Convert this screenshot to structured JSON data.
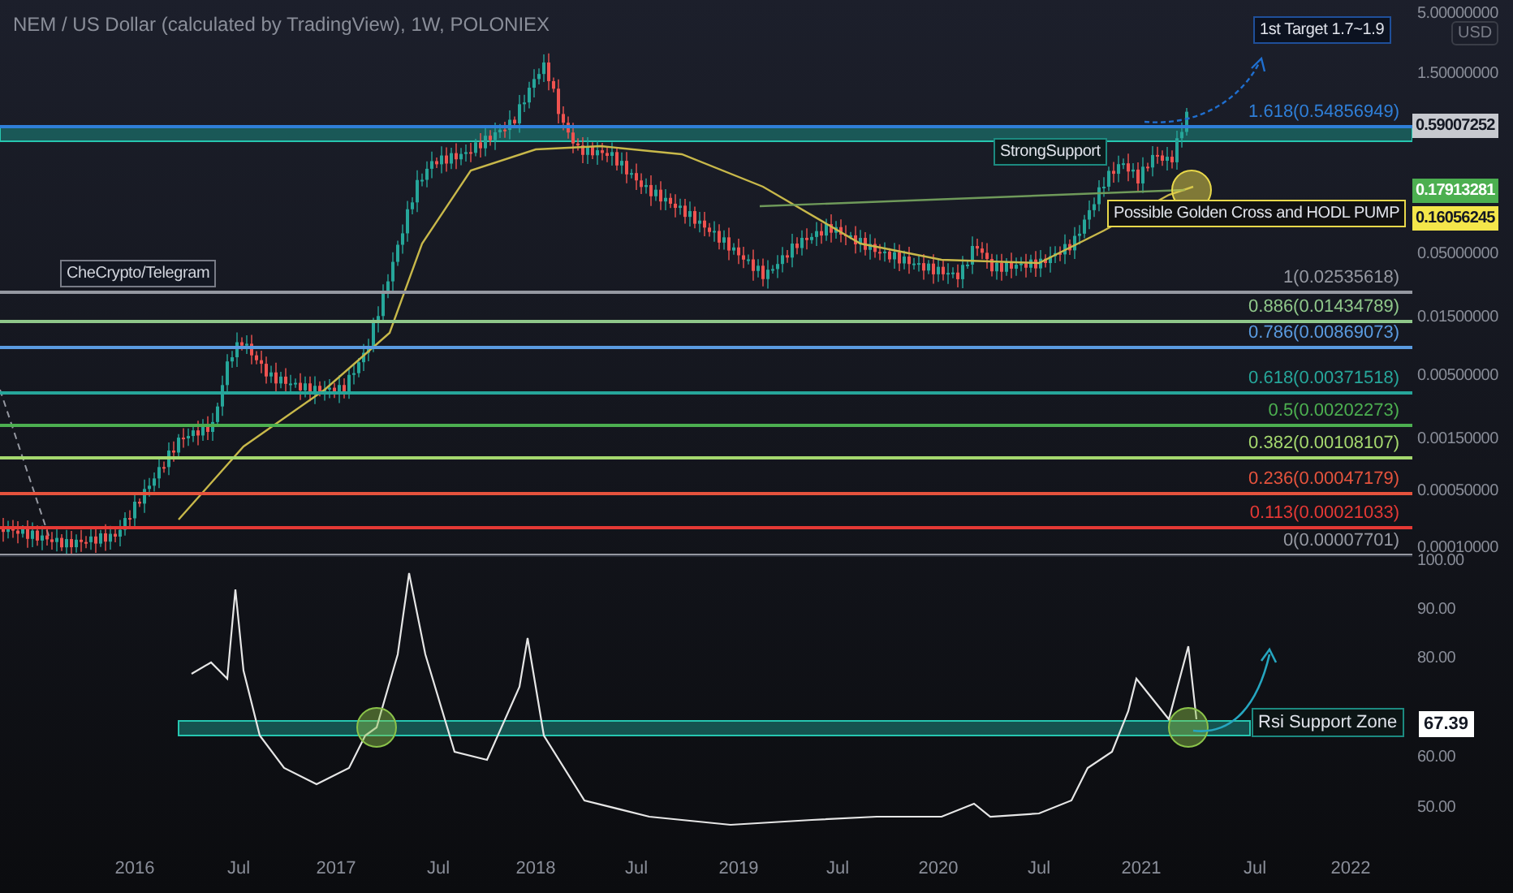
{
  "chart": {
    "title": "NEM / US Dollar (calculated by TradingView), 1W, POLONIEX"
  },
  "annotations": [
    {
      "kind": "target",
      "text": "1st Target 1.7~1.9"
    },
    {
      "kind": "support",
      "text": "StrongSupport"
    },
    {
      "kind": "note",
      "text": "Possible Golden Cross and HODL PUMP"
    },
    {
      "kind": "label",
      "text": "CheCrypto/Telegram"
    }
  ],
  "fib_levels": [
    {
      "label": "1.618(0.54856949)",
      "color": "#2f7fd8"
    },
    {
      "label": "1(0.02535618)",
      "color": "#9598a1"
    },
    {
      "label": "0.886(0.01434789)",
      "color": "#8fc78a"
    },
    {
      "label": "0.786(0.00869073)",
      "color": "#5a9be0"
    },
    {
      "label": "0.618(0.00371518)",
      "color": "#26a69a"
    },
    {
      "label": "0.5(0.00202273)",
      "color": "#4caf50"
    },
    {
      "label": "0.382(0.00108107)",
      "color": "#a5d86e"
    },
    {
      "label": "0.236(0.00047179)",
      "color": "#e5533d"
    },
    {
      "label": "0.113(0.00021033)",
      "color": "#e53935"
    },
    {
      "label": "0(0.00007701)",
      "color": "#9598a1"
    }
  ],
  "price_axis": {
    "currency": "USD",
    "labels": [
      {
        "kind": "tick",
        "text": "5.00000000"
      },
      {
        "kind": "tick",
        "text": "1.50000000"
      },
      {
        "kind": "last",
        "text": "0.59007252"
      },
      {
        "kind": "ma_fast",
        "text": "0.17913281"
      },
      {
        "kind": "ma_slow",
        "text": "0.16056245"
      },
      {
        "kind": "tick",
        "text": "0.05000000"
      },
      {
        "kind": "tick",
        "text": "0.01500000"
      },
      {
        "kind": "tick",
        "text": "0.00500000"
      },
      {
        "kind": "tick",
        "text": "0.00150000"
      },
      {
        "kind": "tick",
        "text": "0.00050000"
      },
      {
        "kind": "tick",
        "text": "0.00010000"
      }
    ]
  },
  "rsi": {
    "annotation": "Rsi Support Zone",
    "value": "67.39",
    "axis": [
      "100.00",
      "90.00",
      "80.00",
      "60.00",
      "50.00"
    ]
  },
  "time_axis": [
    "2016",
    "Jul",
    "2017",
    "Jul",
    "2018",
    "Jul",
    "2019",
    "Jul",
    "2020",
    "Jul",
    "2021",
    "Jul",
    "2022"
  ]
}
